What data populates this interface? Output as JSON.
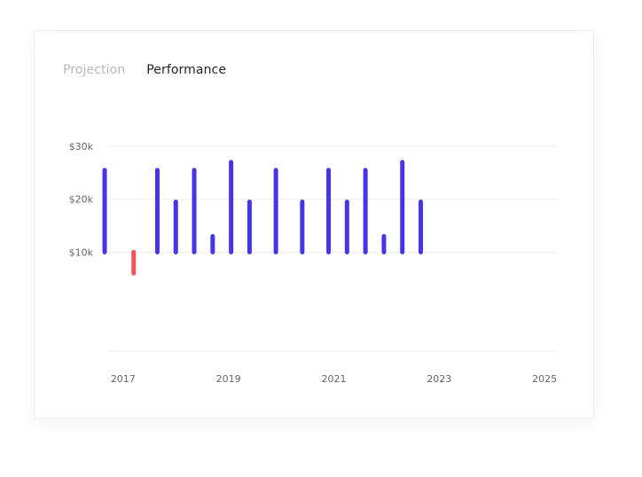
{
  "tabs": [
    {
      "label": "Projection",
      "active": false
    },
    {
      "label": "Performance",
      "active": true
    }
  ],
  "colors": {
    "positive": "#4535e6",
    "negative": "#f2545b",
    "grid": "#eeeeee",
    "tab_inactive": "#b8b8b8",
    "tab_active": "#222222"
  },
  "chart_data": {
    "type": "bar",
    "title": "",
    "xlabel": "",
    "ylabel": "",
    "ylim": [
      -8.7,
      30
    ],
    "xlim": [
      2016.7,
      2025.25
    ],
    "y_ticks": [
      {
        "value": 10,
        "label": "$10k"
      },
      {
        "value": 20,
        "label": "$20k"
      },
      {
        "value": 30,
        "label": "$30k"
      }
    ],
    "x_ticks": [
      {
        "value": 2017,
        "label": "2017"
      },
      {
        "value": 2019,
        "label": "2019"
      },
      {
        "value": 2021,
        "label": "2021"
      },
      {
        "value": 2023,
        "label": "2023"
      },
      {
        "value": 2025,
        "label": "2025"
      }
    ],
    "baseline": 10,
    "grid": true,
    "legend": "none",
    "series": [
      {
        "x": [
          2016.65,
          2017.2,
          2017.65,
          2018.0,
          2018.35,
          2018.7,
          2019.05,
          2019.4,
          2019.9,
          2020.4,
          2020.9,
          2021.25,
          2021.6,
          2021.95,
          2022.3,
          2022.65
        ],
        "values": [
          25.5,
          6.0,
          25.5,
          19.5,
          25.5,
          13.0,
          27.0,
          19.5,
          25.5,
          19.5,
          25.5,
          19.5,
          25.5,
          13.0,
          27.0,
          19.5
        ]
      }
    ]
  }
}
